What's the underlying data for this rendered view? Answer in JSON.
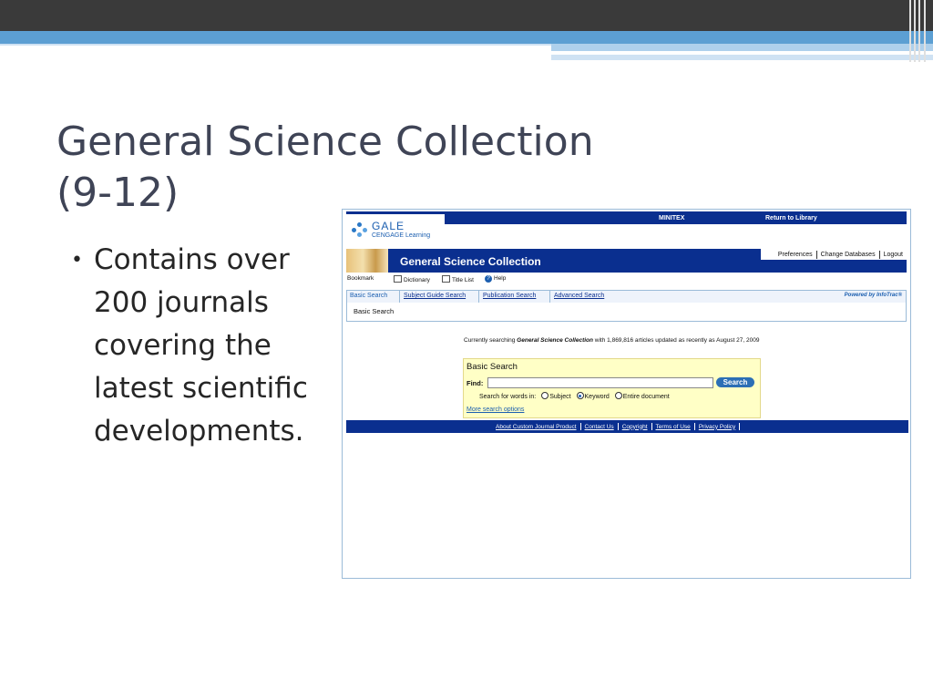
{
  "slide": {
    "title_line1": "General Science Collection",
    "title_line2": "(9-12)",
    "bullet_marker": "•",
    "bullet_lines": [
      "Contains over",
      "200 journals",
      "covering the",
      "latest scientific",
      "developments."
    ]
  },
  "gale": {
    "logo_gale": "GALE",
    "logo_cengage": "CENGAGE Learning",
    "top_links": {
      "minitex": "MINITEX",
      "return": "Return to Library"
    },
    "banner_title": "General Science Collection",
    "prefs_links": [
      "Preferences",
      "Change Databases",
      "Logout"
    ],
    "toolbar": {
      "bookmark": "Bookmark",
      "dictionary": "Dictionary",
      "title_list": "Title List",
      "help": "Help"
    },
    "tabs": [
      "Basic Search",
      "Subject Guide Search",
      "Publication Search",
      "Advanced Search"
    ],
    "powered_by": "Powered by InfoTrac®",
    "breadcrumb": "Basic Search",
    "currently_prefix": "Currently searching ",
    "currently_db": "General Science Collection",
    "currently_suffix": " with 1,869,816 articles updated as recently as August 27, 2009",
    "search_box": {
      "title": "Basic Search",
      "find_label": "Find:",
      "find_value": "",
      "button": "Search",
      "search_for_label": "Search for words in:",
      "options": [
        "Subject",
        "Keyword",
        "Entire document"
      ],
      "selected_option": "Keyword",
      "more_options": "More search options"
    },
    "footer_links": [
      "About Custom Journal Product",
      "Contact Us",
      "Copyright",
      "Terms of Use",
      "Privacy Policy"
    ],
    "colors": {
      "navy": "#0a2f8f",
      "search_panel": "#ffffc6",
      "accent_blue": "#1c5fb0"
    }
  }
}
